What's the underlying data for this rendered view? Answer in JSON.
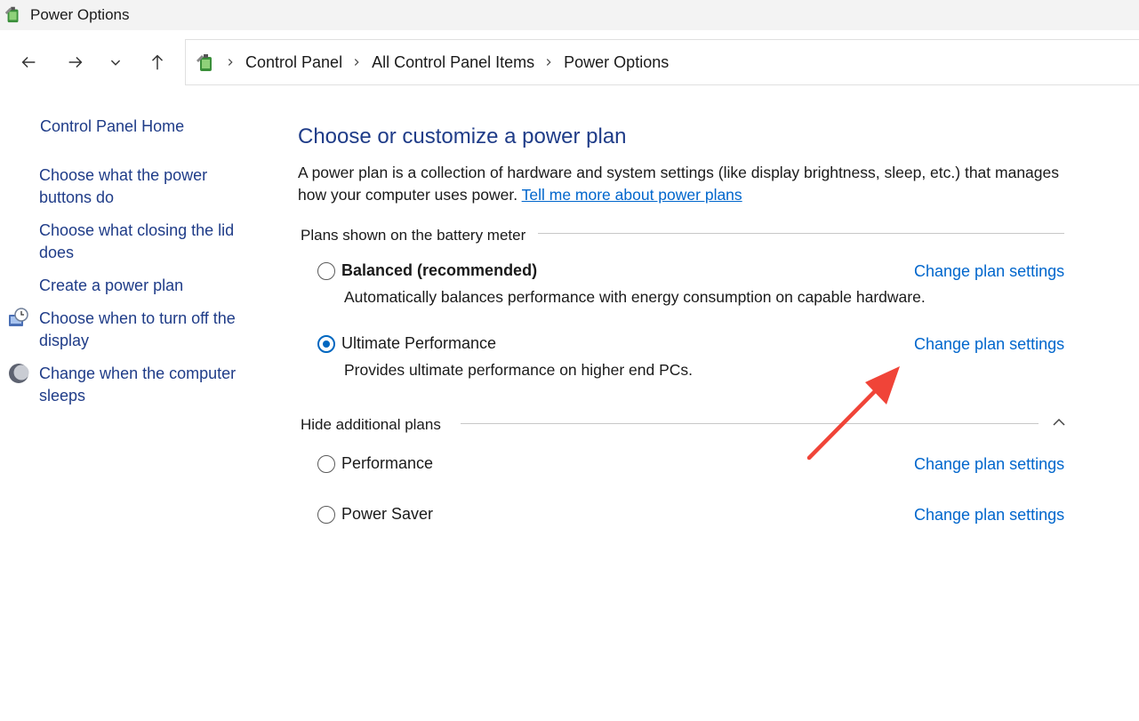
{
  "window": {
    "title": "Power Options"
  },
  "nav": {
    "back": "back-arrow",
    "forward": "forward-arrow",
    "recent": "chevron-down",
    "up": "up-arrow"
  },
  "breadcrumb": {
    "items": [
      "Control Panel",
      "All Control Panel Items",
      "Power Options"
    ]
  },
  "sidebar": {
    "home": "Control Panel Home",
    "links": [
      "Choose what the power buttons do",
      "Choose what closing the lid does",
      "Create a power plan",
      "Choose when to turn off the display",
      "Change when the computer sleeps"
    ]
  },
  "main": {
    "title": "Choose or customize a power plan",
    "description": "A power plan is a collection of hardware and system settings (like display brightness, sleep, etc.) that manages how your computer uses power.",
    "learn_more": "Tell me more about power plans",
    "battery_group_label": "Plans shown on the battery meter",
    "additional_group_label": "Hide additional plans",
    "change_label": "Change plan settings",
    "plans": [
      {
        "name": "Balanced (recommended)",
        "description": "Automatically balances performance with energy consumption on capable hardware.",
        "selected": false
      },
      {
        "name": "Ultimate Performance",
        "description": "Provides ultimate performance on higher end PCs.",
        "selected": true
      },
      {
        "name": "Performance",
        "selected": false
      },
      {
        "name": "Power Saver",
        "selected": false
      }
    ]
  },
  "colors": {
    "link": "#0066cc",
    "heading": "#1f3c88",
    "radio_selected": "#0067c0",
    "annotation_arrow": "#f04438"
  }
}
